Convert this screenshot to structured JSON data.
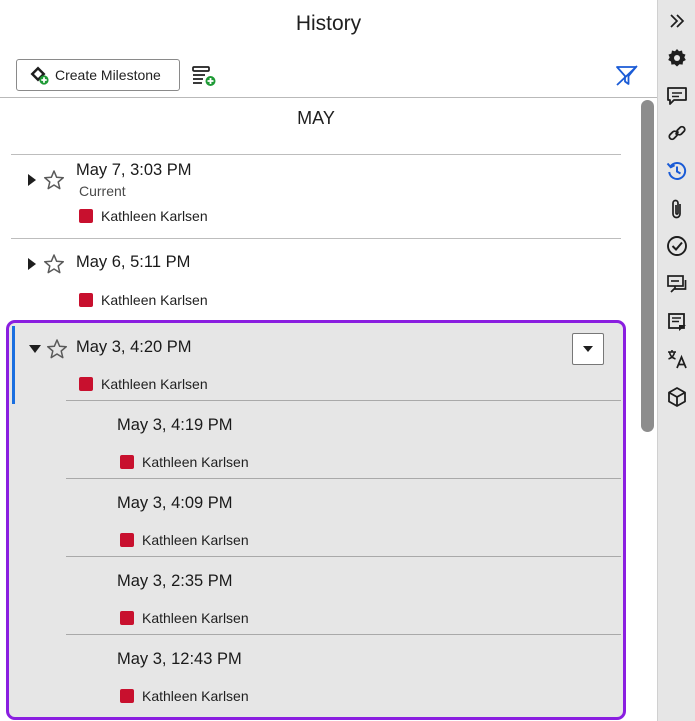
{
  "panel": {
    "title": "History",
    "create_milestone_label": "Create Milestone",
    "month": "MAY"
  },
  "entries": [
    {
      "time": "May 7, 3:03 PM",
      "sub": "Current",
      "author": "Kathleen Karlsen",
      "expanded": false
    },
    {
      "time": "May 6, 5:11 PM",
      "sub": "",
      "author": "Kathleen Karlsen",
      "expanded": false
    }
  ],
  "group": {
    "time": "May 3, 4:20 PM",
    "author": "Kathleen Karlsen",
    "expanded": true,
    "children": [
      {
        "time": "May 3, 4:19 PM",
        "author": "Kathleen Karlsen"
      },
      {
        "time": "May 3, 4:09 PM",
        "author": "Kathleen Karlsen"
      },
      {
        "time": "May 3, 2:35 PM",
        "author": "Kathleen Karlsen"
      },
      {
        "time": "May 3, 12:43 PM",
        "author": "Kathleen Karlsen"
      }
    ]
  },
  "colors": {
    "author_swatch": "#c8102e",
    "highlight_border": "#8a1ee0",
    "accent_blue": "#1a6fe0",
    "history_icon_blue": "#1a5bd6"
  },
  "rail_icons": [
    "collapse-panel-icon",
    "settings-gear-icon",
    "comments-icon",
    "link-icon",
    "history-icon",
    "attachment-icon",
    "task-check-icon",
    "discussions-icon",
    "notes-icon",
    "translate-icon",
    "package-cube-icon"
  ]
}
